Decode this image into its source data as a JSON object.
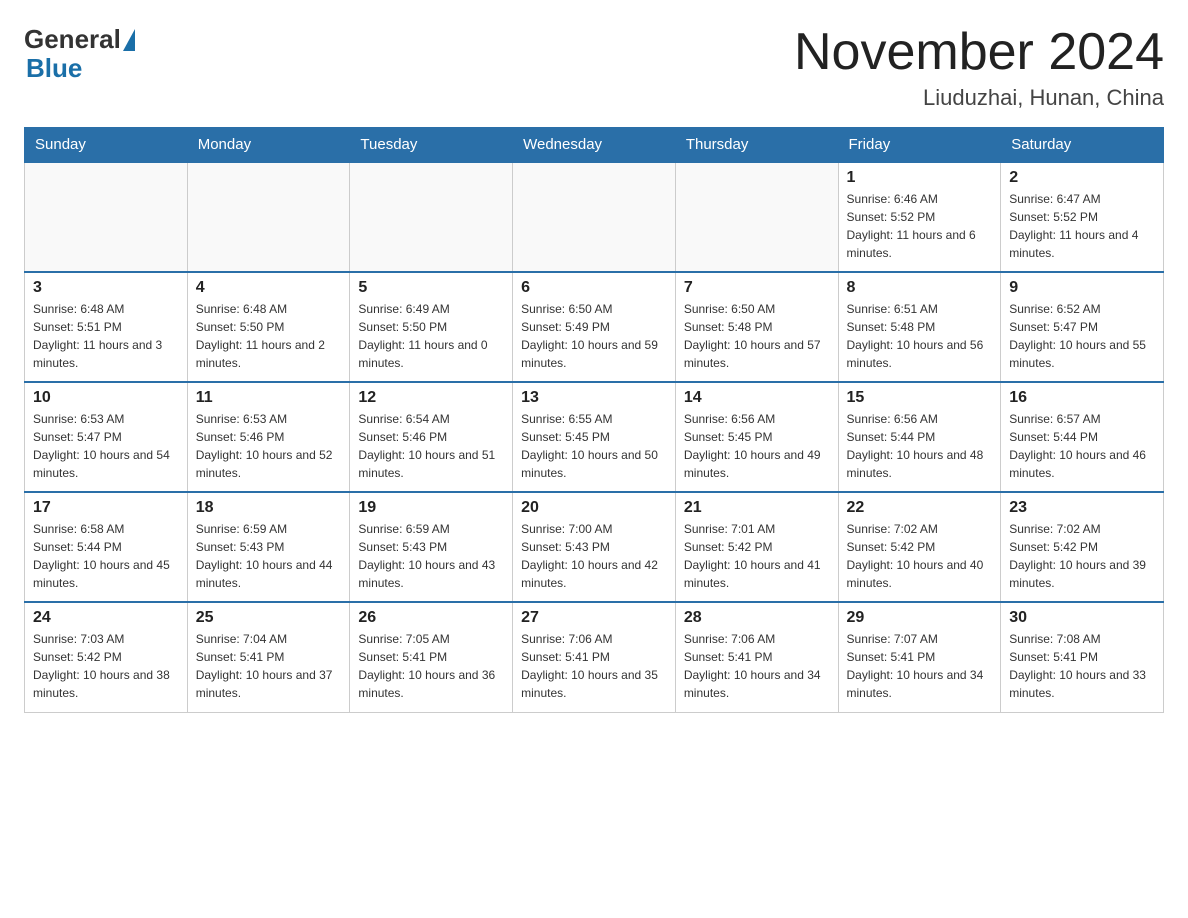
{
  "header": {
    "logo_general": "General",
    "logo_blue": "Blue",
    "title": "November 2024",
    "subtitle": "Liuduzhai, Hunan, China"
  },
  "weekdays": [
    "Sunday",
    "Monday",
    "Tuesday",
    "Wednesday",
    "Thursday",
    "Friday",
    "Saturday"
  ],
  "weeks": [
    [
      {
        "day": "",
        "info": ""
      },
      {
        "day": "",
        "info": ""
      },
      {
        "day": "",
        "info": ""
      },
      {
        "day": "",
        "info": ""
      },
      {
        "day": "",
        "info": ""
      },
      {
        "day": "1",
        "info": "Sunrise: 6:46 AM\nSunset: 5:52 PM\nDaylight: 11 hours and 6 minutes."
      },
      {
        "day": "2",
        "info": "Sunrise: 6:47 AM\nSunset: 5:52 PM\nDaylight: 11 hours and 4 minutes."
      }
    ],
    [
      {
        "day": "3",
        "info": "Sunrise: 6:48 AM\nSunset: 5:51 PM\nDaylight: 11 hours and 3 minutes."
      },
      {
        "day": "4",
        "info": "Sunrise: 6:48 AM\nSunset: 5:50 PM\nDaylight: 11 hours and 2 minutes."
      },
      {
        "day": "5",
        "info": "Sunrise: 6:49 AM\nSunset: 5:50 PM\nDaylight: 11 hours and 0 minutes."
      },
      {
        "day": "6",
        "info": "Sunrise: 6:50 AM\nSunset: 5:49 PM\nDaylight: 10 hours and 59 minutes."
      },
      {
        "day": "7",
        "info": "Sunrise: 6:50 AM\nSunset: 5:48 PM\nDaylight: 10 hours and 57 minutes."
      },
      {
        "day": "8",
        "info": "Sunrise: 6:51 AM\nSunset: 5:48 PM\nDaylight: 10 hours and 56 minutes."
      },
      {
        "day": "9",
        "info": "Sunrise: 6:52 AM\nSunset: 5:47 PM\nDaylight: 10 hours and 55 minutes."
      }
    ],
    [
      {
        "day": "10",
        "info": "Sunrise: 6:53 AM\nSunset: 5:47 PM\nDaylight: 10 hours and 54 minutes."
      },
      {
        "day": "11",
        "info": "Sunrise: 6:53 AM\nSunset: 5:46 PM\nDaylight: 10 hours and 52 minutes."
      },
      {
        "day": "12",
        "info": "Sunrise: 6:54 AM\nSunset: 5:46 PM\nDaylight: 10 hours and 51 minutes."
      },
      {
        "day": "13",
        "info": "Sunrise: 6:55 AM\nSunset: 5:45 PM\nDaylight: 10 hours and 50 minutes."
      },
      {
        "day": "14",
        "info": "Sunrise: 6:56 AM\nSunset: 5:45 PM\nDaylight: 10 hours and 49 minutes."
      },
      {
        "day": "15",
        "info": "Sunrise: 6:56 AM\nSunset: 5:44 PM\nDaylight: 10 hours and 48 minutes."
      },
      {
        "day": "16",
        "info": "Sunrise: 6:57 AM\nSunset: 5:44 PM\nDaylight: 10 hours and 46 minutes."
      }
    ],
    [
      {
        "day": "17",
        "info": "Sunrise: 6:58 AM\nSunset: 5:44 PM\nDaylight: 10 hours and 45 minutes."
      },
      {
        "day": "18",
        "info": "Sunrise: 6:59 AM\nSunset: 5:43 PM\nDaylight: 10 hours and 44 minutes."
      },
      {
        "day": "19",
        "info": "Sunrise: 6:59 AM\nSunset: 5:43 PM\nDaylight: 10 hours and 43 minutes."
      },
      {
        "day": "20",
        "info": "Sunrise: 7:00 AM\nSunset: 5:43 PM\nDaylight: 10 hours and 42 minutes."
      },
      {
        "day": "21",
        "info": "Sunrise: 7:01 AM\nSunset: 5:42 PM\nDaylight: 10 hours and 41 minutes."
      },
      {
        "day": "22",
        "info": "Sunrise: 7:02 AM\nSunset: 5:42 PM\nDaylight: 10 hours and 40 minutes."
      },
      {
        "day": "23",
        "info": "Sunrise: 7:02 AM\nSunset: 5:42 PM\nDaylight: 10 hours and 39 minutes."
      }
    ],
    [
      {
        "day": "24",
        "info": "Sunrise: 7:03 AM\nSunset: 5:42 PM\nDaylight: 10 hours and 38 minutes."
      },
      {
        "day": "25",
        "info": "Sunrise: 7:04 AM\nSunset: 5:41 PM\nDaylight: 10 hours and 37 minutes."
      },
      {
        "day": "26",
        "info": "Sunrise: 7:05 AM\nSunset: 5:41 PM\nDaylight: 10 hours and 36 minutes."
      },
      {
        "day": "27",
        "info": "Sunrise: 7:06 AM\nSunset: 5:41 PM\nDaylight: 10 hours and 35 minutes."
      },
      {
        "day": "28",
        "info": "Sunrise: 7:06 AM\nSunset: 5:41 PM\nDaylight: 10 hours and 34 minutes."
      },
      {
        "day": "29",
        "info": "Sunrise: 7:07 AM\nSunset: 5:41 PM\nDaylight: 10 hours and 34 minutes."
      },
      {
        "day": "30",
        "info": "Sunrise: 7:08 AM\nSunset: 5:41 PM\nDaylight: 10 hours and 33 minutes."
      }
    ]
  ]
}
